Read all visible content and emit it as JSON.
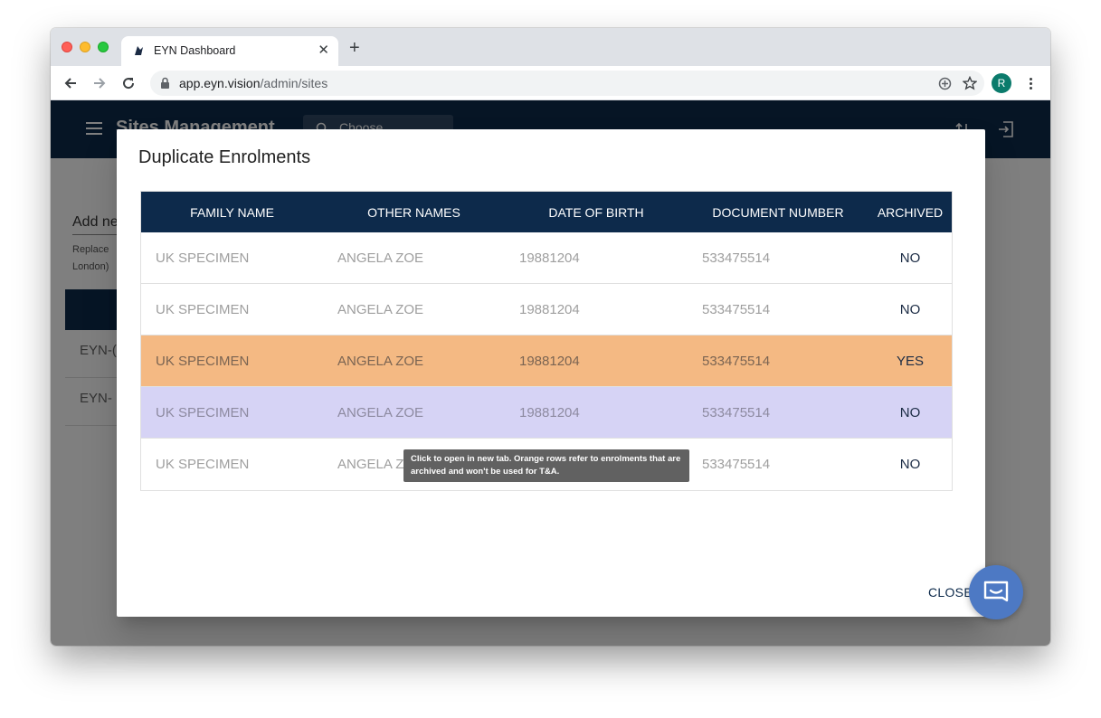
{
  "browser": {
    "tab_title": "EYN Dashboard",
    "url_host": "app.eyn.vision",
    "url_path": "/admin/sites",
    "profile_initial": "R"
  },
  "app": {
    "title": "Sites Management",
    "choose_placeholder": "Choose",
    "add_label": "Add ne",
    "helper_line1": "Replace",
    "helper_line2": "London)",
    "bg_rows": [
      "EYN-(",
      "EYN-"
    ]
  },
  "dialog": {
    "title": "Duplicate Enrolments",
    "columns": [
      "FAMILY NAME",
      "OTHER NAMES",
      "DATE OF BIRTH",
      "DOCUMENT NUMBER",
      "ARCHIVED"
    ],
    "rows": [
      {
        "family": "UK SPECIMEN",
        "other": "ANGELA ZOE",
        "dob": "19881204",
        "doc": "533475514",
        "archived": "NO"
      },
      {
        "family": "UK SPECIMEN",
        "other": "ANGELA ZOE",
        "dob": "19881204",
        "doc": "533475514",
        "archived": "NO"
      },
      {
        "family": "UK SPECIMEN",
        "other": "ANGELA ZOE",
        "dob": "19881204",
        "doc": "533475514",
        "archived": "YES"
      },
      {
        "family": "UK SPECIMEN",
        "other": "ANGELA ZOE",
        "dob": "19881204",
        "doc": "533475514",
        "archived": "NO"
      },
      {
        "family": "UK SPECIMEN",
        "other": "ANGELA Z",
        "dob": "",
        "doc": "533475514",
        "archived": "NO"
      }
    ],
    "tooltip": "Click to open in new tab. Orange rows refer to enrolments that are archived and won't be used for T&A.",
    "close_label": "CLOSE"
  },
  "colors": {
    "navy": "#0d2a4b",
    "archived_row": "#f4b983",
    "hover_row": "#d6d3f5",
    "chat": "#4d79c4"
  }
}
